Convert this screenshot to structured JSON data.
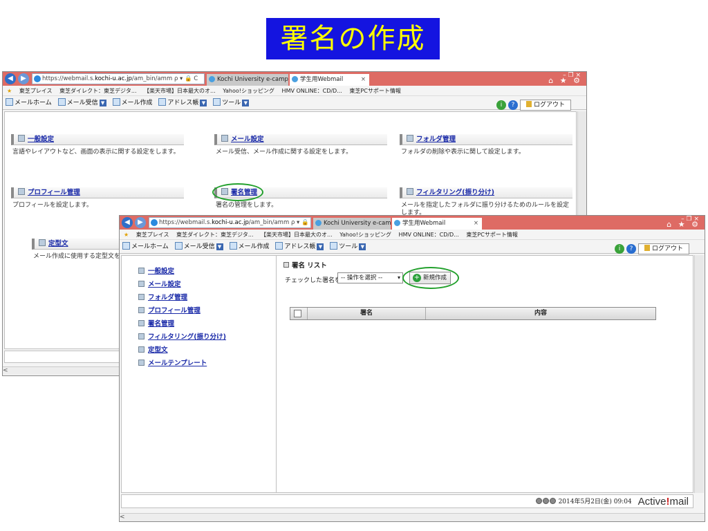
{
  "banner": {
    "title": "署名の作成"
  },
  "browser": {
    "url_prefix": "https://webmail.s.",
    "url_host_w1": "kochi-u.ac.jp",
    "url_host_w2": "kochi-u.ac.jp",
    "url_path": "/am_bin/amm",
    "addr_controls": "ρ ▾ 🔒 C",
    "tabs": [
      "Kochi University e-campus",
      "学生用Webmail"
    ],
    "tab_close": "×",
    "window_controls": "– ❐ ×",
    "toolbar_icons": "⌂ ★ ⚙",
    "favorites": [
      "東芝プレイス",
      "東芝ダイレクト：東芝デジタ...",
      "【楽天市場】日本最大のオ...",
      "Yahoo!ショッピング",
      "HMV ONLINE：CD/D...",
      "東芝PCサポート情報"
    ]
  },
  "toolbar": {
    "items": [
      "メールホーム",
      "メール受信",
      "メール作成",
      "アドレス帳",
      "ツール"
    ],
    "logout": "ログアウト"
  },
  "settings_page": {
    "items": [
      {
        "title": "一般設定",
        "desc": "言語やレイアウトなど、画面の表示に関する設定をします。"
      },
      {
        "title": "メール設定",
        "desc": "メール受信、メール作成に関する設定をします。"
      },
      {
        "title": "フォルダ管理",
        "desc": "フォルダの削除や表示に関して設定します。"
      },
      {
        "title": "プロフィール管理",
        "desc": "プロフィールを設定します。"
      },
      {
        "title": "署名管理",
        "desc": "署名の管理をします。"
      },
      {
        "title": "フィルタリング(振り分け)",
        "desc": "メールを指定したフォルダに振り分けるためのルールを設定します。"
      },
      {
        "title": "定型文",
        "desc": "メール作成に使用する定型文を"
      }
    ]
  },
  "sidebar": {
    "items": [
      "一般設定",
      "メール設定",
      "フォルダ管理",
      "プロフィール管理",
      "署名管理",
      "フィルタリング(振り分け)",
      "定型文",
      "メールテンプレート"
    ]
  },
  "signature_page": {
    "title": "署名 リスト",
    "check_label": "チェックした署名を",
    "operation_select": "-- 操作を選択 --",
    "new_button": "新規作成",
    "columns": [
      "署名",
      "内容"
    ]
  },
  "status": {
    "datetime": "2014年5月2日(金) 09:04",
    "logo_prefix": "Active",
    "logo_suffix": "mail"
  }
}
